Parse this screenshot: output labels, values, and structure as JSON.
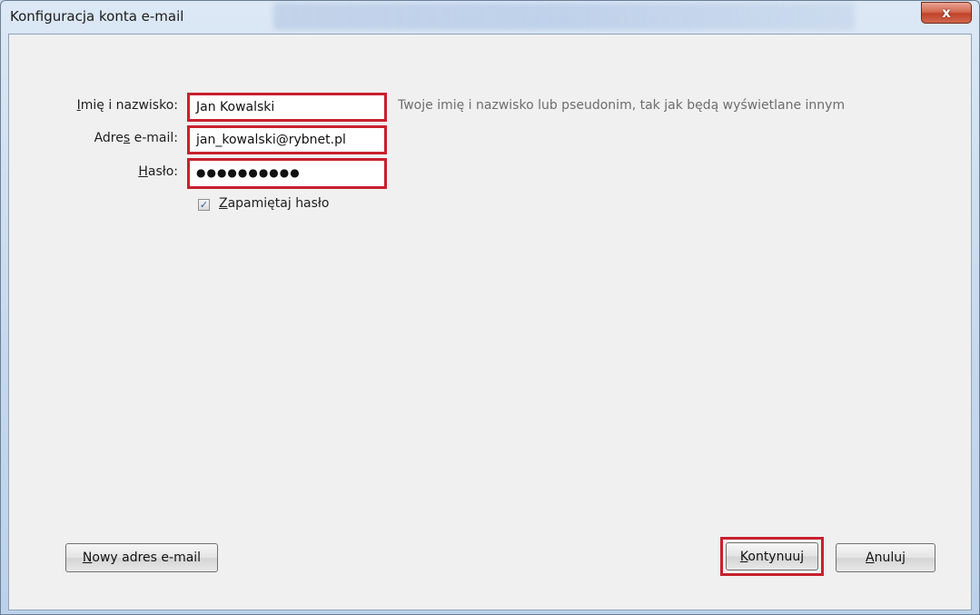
{
  "window": {
    "title": "Konfiguracja konta e-mail",
    "close_glyph": "x"
  },
  "form": {
    "name_label": "Imię i nazwisko:",
    "name_value": "Jan Kowalski",
    "name_hint": "Twoje imię i nazwisko lub pseudonim, tak jak będą wyświetlane innym",
    "email_label": "Adres e-mail:",
    "email_value": "jan_kowalski@rybnet.pl",
    "password_label": "Hasło:",
    "password_value": "●●●●●●●●●●",
    "remember_label": "Zapamiętaj hasło",
    "remember_checked": true
  },
  "buttons": {
    "new_address": "Nowy adres e-mail",
    "continue": "Kontynuuj",
    "cancel": "Anuluj"
  },
  "colors": {
    "highlight": "#c8202e",
    "hint_text": "#6d6d6d",
    "client_bg": "#f0f0f0",
    "close_button": "#c0432a"
  },
  "icons": {
    "close": "close-icon",
    "checkbox": "checkmark-icon"
  }
}
